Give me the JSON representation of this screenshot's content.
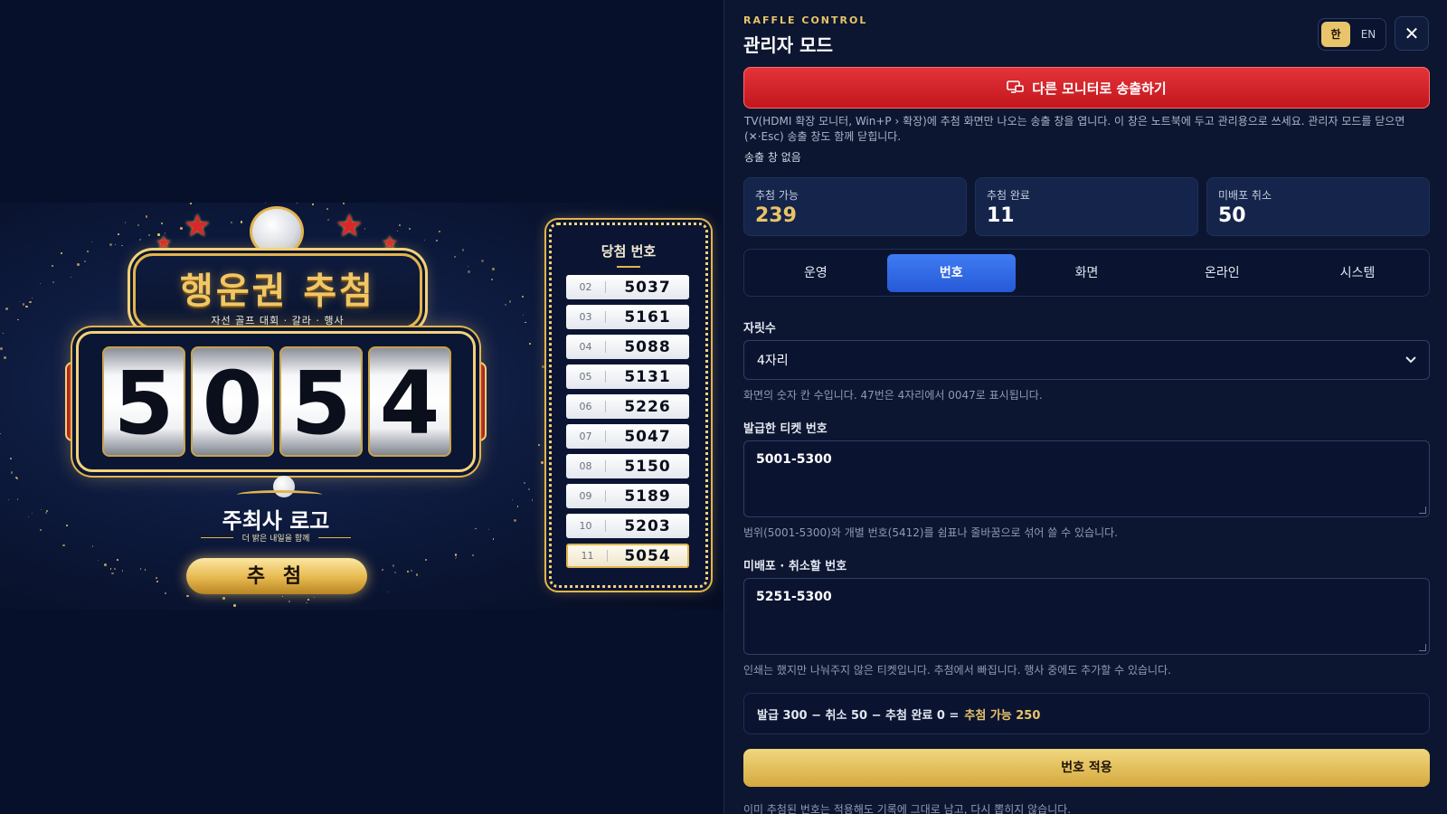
{
  "stage": {
    "title": "행운권 추첨",
    "subtitle": "자선 골프 대회 · 갈라 · 행사",
    "digits": [
      "5",
      "0",
      "5",
      "4"
    ],
    "sponsor_name": "주최사 로고",
    "sponsor_tagline": "더 밝은 내일을 함께",
    "draw_button": "추 첨",
    "winners_title": "당첨 번호",
    "winners": [
      {
        "idx": "02",
        "num": "5037"
      },
      {
        "idx": "03",
        "num": "5161"
      },
      {
        "idx": "04",
        "num": "5088"
      },
      {
        "idx": "05",
        "num": "5131"
      },
      {
        "idx": "06",
        "num": "5226"
      },
      {
        "idx": "07",
        "num": "5047"
      },
      {
        "idx": "08",
        "num": "5150"
      },
      {
        "idx": "09",
        "num": "5189"
      },
      {
        "idx": "10",
        "num": "5203"
      },
      {
        "idx": "11",
        "num": "5054"
      }
    ]
  },
  "panel": {
    "eyebrow": "RAFFLE CONTROL",
    "title": "관리자 모드",
    "lang_ko": "한",
    "lang_en": "EN",
    "close": "✕",
    "broadcast_button": "다른 모니터로 송출하기",
    "broadcast_desc": "TV(HDMI 확장 모니터, Win+P › 확장)에 추첨 화면만 나오는 송출 창을 엽니다. 이 창은 노트북에 두고 관리용으로 쓰세요. 관리자 모드를 닫으면(✕·Esc) 송출 창도 함께 닫힙니다.",
    "broadcast_status": "송출 창 없음",
    "stats": [
      {
        "label": "추첨 가능",
        "value": "239"
      },
      {
        "label": "추첨 완료",
        "value": "11"
      },
      {
        "label": "미배포 취소",
        "value": "50"
      }
    ],
    "tabs": [
      "운영",
      "번호",
      "화면",
      "온라인",
      "시스템"
    ],
    "active_tab": "번호",
    "digits_label": "자릿수",
    "digits_value": "4자리",
    "digits_help": "화면의 숫자 칸 수입니다. 47번은 4자리에서 0047로 표시됩니다.",
    "issued_label": "발급한 티켓 번호",
    "issued_value": "5001-5300",
    "issued_help": "범위(5001-5300)와 개별 번호(5412)를 쉼표나 줄바꿈으로 섞어 쓸 수 있습니다.",
    "cancel_label": "미배포 · 취소할 번호",
    "cancel_value": "5251-5300",
    "cancel_help": "인쇄는 했지만 나눠주지 않은 티켓입니다. 추첨에서 빠집니다. 행사 중에도 추가할 수 있습니다.",
    "summary_text": "발급 300 − 취소 50 − 추첨 완료 0 =",
    "summary_result": "추첨 가능 250",
    "apply_button": "번호 적용",
    "footer_note": "이미 추첨된 번호는 적용해도 기록에 그대로 남고, 다시 뽑히지 않습니다."
  },
  "colors": {
    "accent_gold": "#e8c46a",
    "broadcast_red": "#d9262d",
    "tab_blue": "#2f6ae6",
    "panel_bg": "#0c1630"
  }
}
